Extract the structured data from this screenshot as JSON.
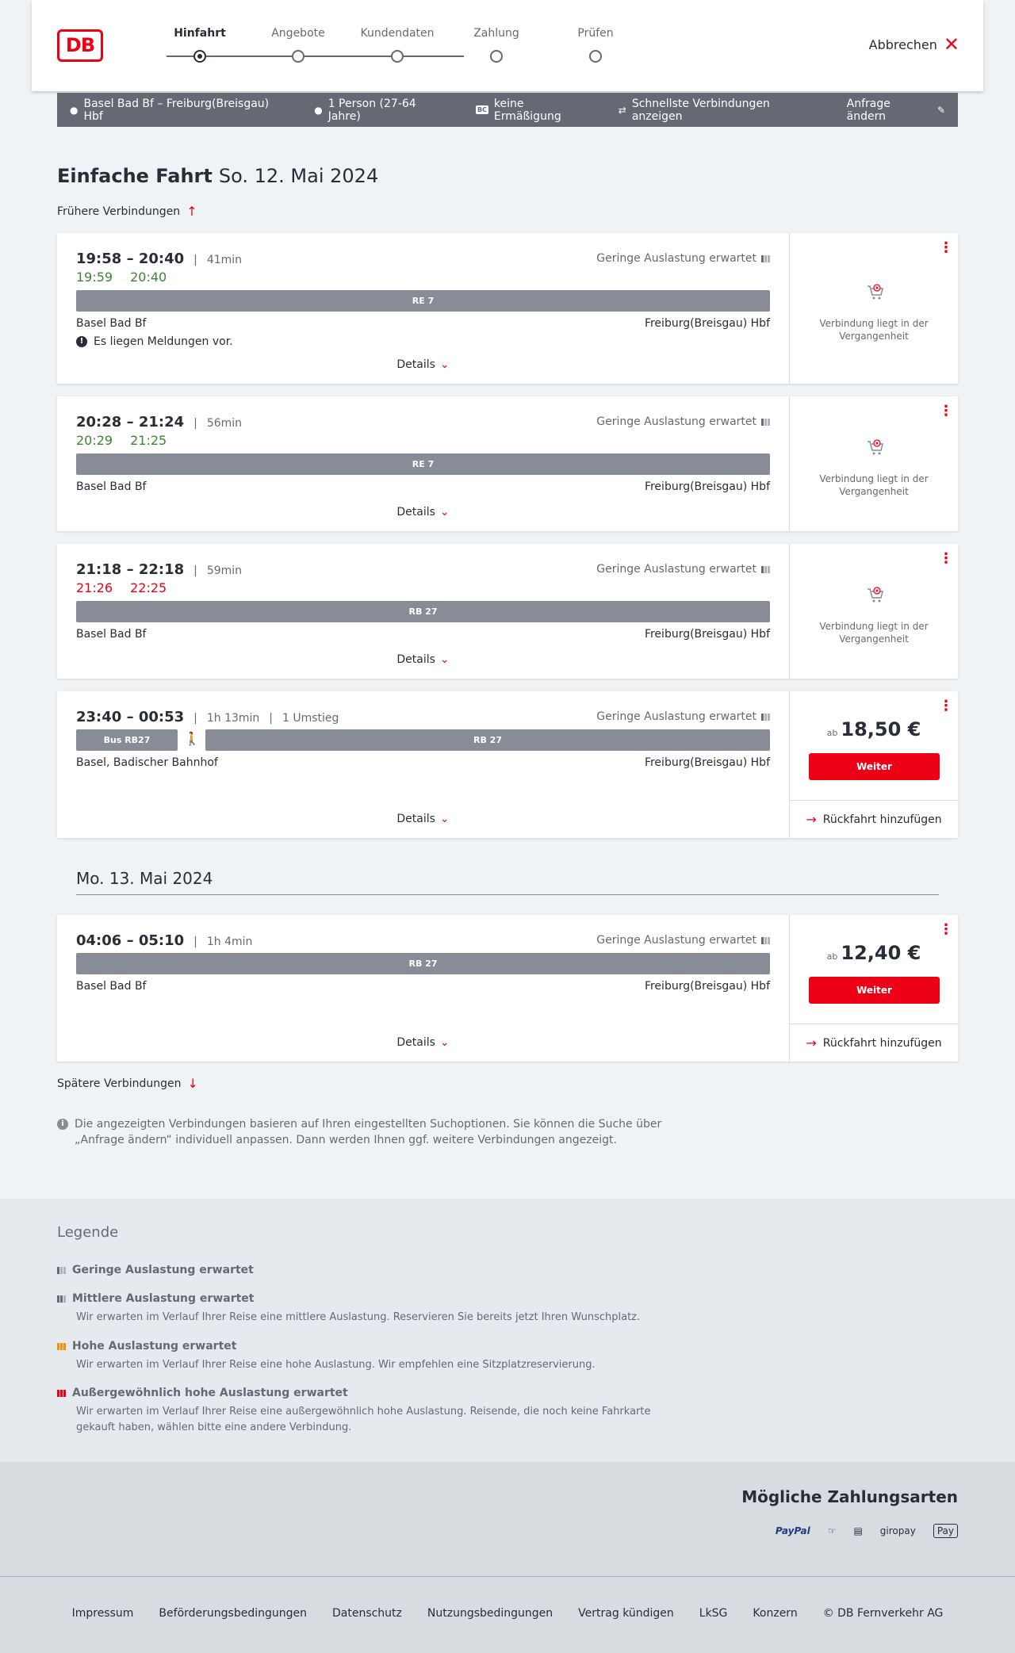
{
  "header": {
    "logo": "DB",
    "steps": [
      "Hinfahrt",
      "Angebote",
      "Kundendaten",
      "Zahlung",
      "Prüfen"
    ],
    "cancel_label": "Abbrechen"
  },
  "search": {
    "route": "Basel Bad Bf – Freiburg(Breisgau) Hbf",
    "passengers": "1 Person (27-64 Jahre)",
    "bc_badge": "BC",
    "discount": "keine Ermäßigung",
    "mode": "Schnellste Verbindungen anzeigen",
    "change_label": "Anfrage ändern"
  },
  "page": {
    "title": "Einfache Fahrt",
    "date": "So. 12. Mai 2024",
    "earlier": "Frühere Verbindungen",
    "later": "Spätere Verbindungen",
    "day2": "Mo. 13. Mai 2024"
  },
  "common": {
    "details": "Details",
    "occupancy": "Geringe Auslastung erwartet",
    "past": "Verbindung liegt in der Vergangenheit",
    "ab": "ab",
    "weiter": "Weiter",
    "rueck": "Rückfahrt hinzufügen"
  },
  "connections": [
    {
      "times": "19:58 – 20:40",
      "duration": "41min",
      "rt_dep": "19:59",
      "rt_arr": "20:40",
      "train": "RE 7",
      "from": "Basel Bad Bf",
      "to": "Freiburg(Breisgau) Hbf",
      "message": "Es liegen Meldungen vor."
    },
    {
      "times": "20:28 – 21:24",
      "duration": "56min",
      "rt_dep": "20:29",
      "rt_arr": "21:25",
      "train": "RE 7",
      "from": "Basel Bad Bf",
      "to": "Freiburg(Breisgau) Hbf"
    },
    {
      "times": "21:18 – 22:18",
      "duration": "59min",
      "rt_dep": "21:26",
      "rt_arr": "22:25",
      "train": "RB 27",
      "from": "Basel Bad Bf",
      "to": "Freiburg(Breisgau) Hbf"
    },
    {
      "times": "23:40 – 00:53",
      "duration": "1h 13min",
      "transfers": "1 Umstieg",
      "train_a": "Bus RB27",
      "train": "RB 27",
      "from": "Basel, Badischer Bahnhof",
      "to": "Freiburg(Breisgau) Hbf",
      "price": "18,50 €"
    },
    {
      "times": "04:06 – 05:10",
      "duration": "1h 4min",
      "train": "RB 27",
      "from": "Basel Bad Bf",
      "to": "Freiburg(Breisgau) Hbf",
      "price": "12,40 €"
    }
  ],
  "info": "Die angezeigten Verbindungen basieren auf Ihren eingestellten Suchoptionen. Sie können die Suche über „Anfrage ändern“ individuell anpassen. Dann werden Ihnen ggf. weitere Verbindungen angezeigt.",
  "legend": {
    "title": "Legende",
    "items": [
      {
        "title": "Geringe Auslastung erwartet",
        "desc": ""
      },
      {
        "title": "Mittlere Auslastung erwartet",
        "desc": "Wir erwarten im Verlauf Ihrer Reise eine mittlere Auslastung. Reservieren Sie bereits jetzt Ihren Wunschplatz."
      },
      {
        "title": "Hohe Auslastung erwartet",
        "desc": "Wir erwarten im Verlauf Ihrer Reise eine hohe Auslastung. Wir empfehlen eine Sitzplatzreservierung."
      },
      {
        "title": "Außergewöhnlich hohe Auslastung erwartet",
        "desc": "Wir erwarten im Verlauf Ihrer Reise eine außergewöhnlich hohe Auslastung. Reisende, die noch keine Fahrkarte gekauft haben, wählen bitte eine andere Verbindung."
      }
    ],
    "colors": {
      "low": "#646973",
      "high": "#f39200",
      "extreme": "#ec0016"
    }
  },
  "payments": {
    "title": "Mögliche Zahlungsarten",
    "methods": [
      "PayPal",
      "giropay",
      "Pay"
    ]
  },
  "footer": [
    "Impressum",
    "Beförderungsbedingungen",
    "Datenschutz",
    "Nutzungsbedingungen",
    "Vertrag kündigen",
    "LkSG",
    "Konzern",
    "© DB Fernverkehr AG"
  ]
}
